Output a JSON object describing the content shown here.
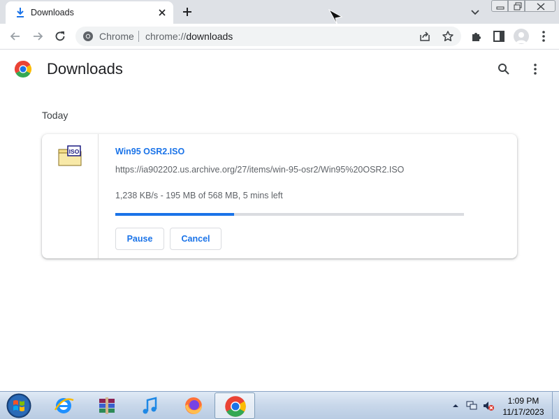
{
  "tab": {
    "title": "Downloads"
  },
  "omnibox": {
    "chip": "Chrome",
    "url_scheme": "chrome://",
    "url_host": "downloads"
  },
  "page": {
    "title": "Downloads",
    "section": "Today"
  },
  "download": {
    "file_name": "Win95 OSR2.ISO",
    "url": "https://ia902202.us.archive.org/27/items/win-95-osr2/Win95%20OSR2.ISO",
    "status": "1,238 KB/s - 195 MB of 568 MB, 5 mins left",
    "progress": 0.34,
    "pause_label": "Pause",
    "cancel_label": "Cancel",
    "icon_text": "ISO"
  },
  "taskbar": {
    "apps": [
      "internet-explorer",
      "winrar",
      "itunes",
      "firefox",
      "chrome"
    ],
    "time": "1:09 PM",
    "date": "11/17/2023"
  },
  "colors": {
    "accent": "#1a73e8",
    "tabstrip": "#dee1e6",
    "omnibox": "#f1f3f4",
    "muted_text": "#5f6368"
  },
  "icons": {
    "tab": "download-icon",
    "omnibox": "chrome-icon",
    "extensions": "puzzle-icon",
    "side_panel": "side-panel-icon",
    "page_search": "search-icon",
    "page_menu": "more-vert-icon"
  }
}
